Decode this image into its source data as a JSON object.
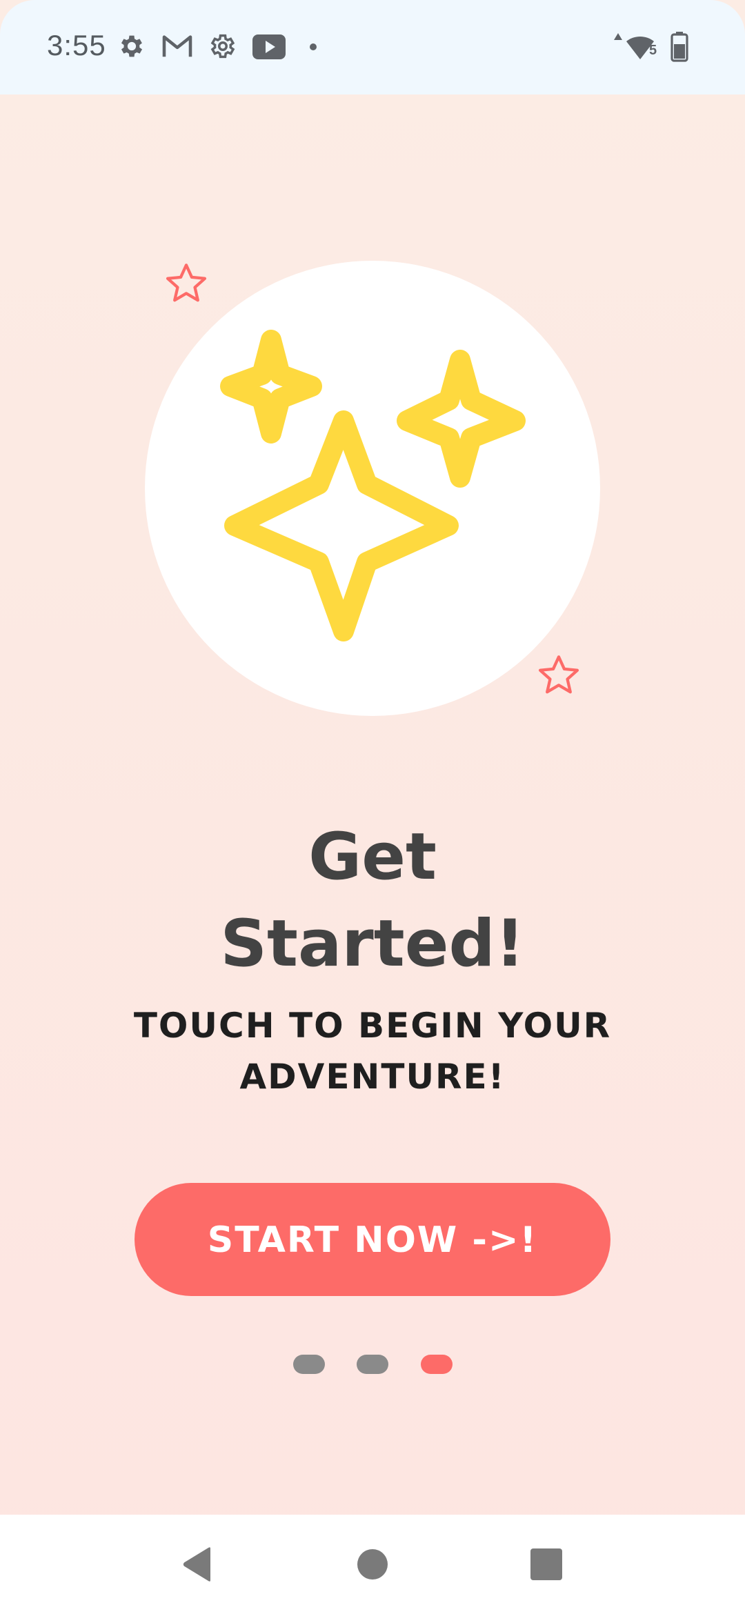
{
  "status_bar": {
    "time": "3:55",
    "left_icons": [
      "settings-gear-icon",
      "gmail-icon",
      "settings-outline-icon",
      "youtube-icon",
      "notification-dot-icon"
    ],
    "right_icons": [
      "wifi-icon",
      "battery-icon"
    ],
    "wifi_badge": "5"
  },
  "hero": {
    "illustration": "sparkles-icon",
    "accent_colors": {
      "sparkle": "#fed93f",
      "star": "#fd6b68"
    }
  },
  "content": {
    "title_line1": "Get",
    "title_line2": "Started!",
    "subtitle_line1": "TOUCH TO BEGIN YOUR",
    "subtitle_line2": "ADVENTURE!",
    "cta_label": "START NOW ->!",
    "cta_color": "#fd6b68"
  },
  "pager": {
    "page_count": 3,
    "current_page": 3
  },
  "nav_bar": {
    "buttons": [
      "back-icon",
      "home-icon",
      "recents-icon"
    ]
  }
}
